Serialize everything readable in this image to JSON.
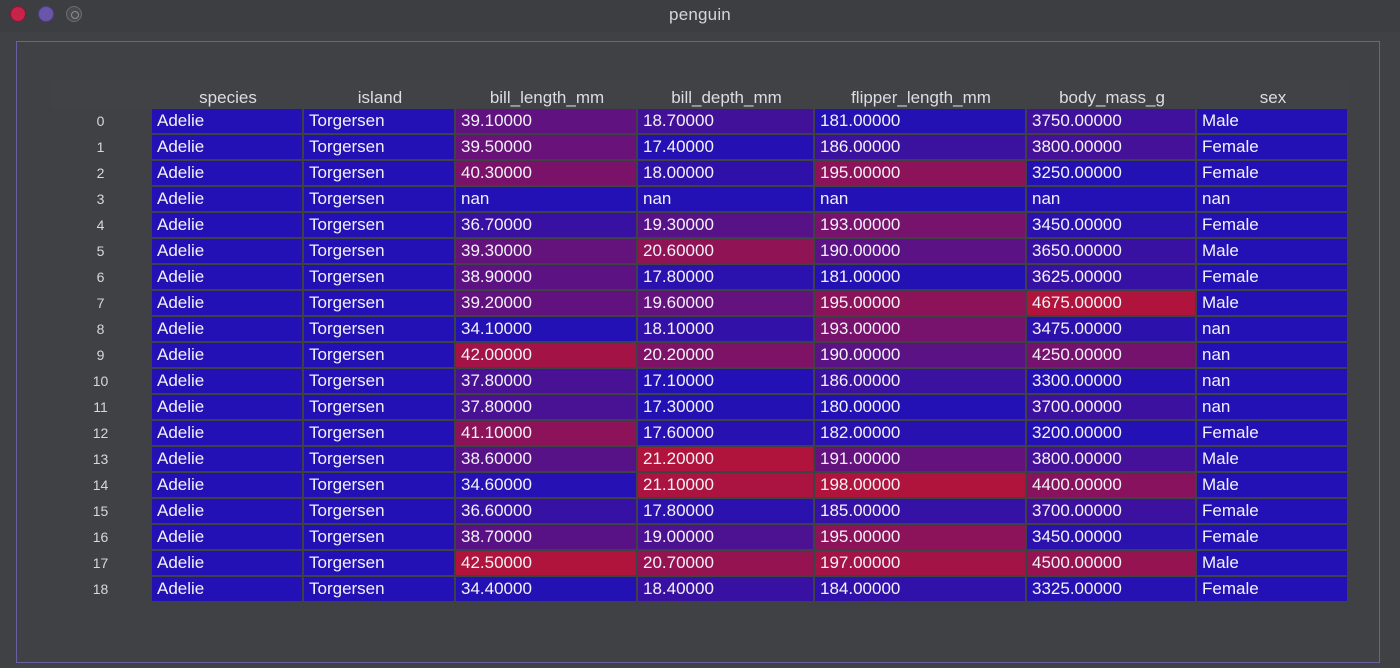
{
  "window": {
    "title": "penguin"
  },
  "colors": {
    "low": "#2311b5",
    "high": "#b0133b",
    "nan": "#2311b5"
  },
  "table": {
    "columns": [
      "species",
      "island",
      "bill_length_mm",
      "bill_depth_mm",
      "flipper_length_mm",
      "body_mass_g",
      "sex"
    ],
    "rows": [
      {
        "index": "0",
        "cells": [
          "Adelie",
          "Torgersen",
          "39.10000",
          "18.70000",
          "181.00000",
          "3750.00000",
          "Male"
        ]
      },
      {
        "index": "1",
        "cells": [
          "Adelie",
          "Torgersen",
          "39.50000",
          "17.40000",
          "186.00000",
          "3800.00000",
          "Female"
        ]
      },
      {
        "index": "2",
        "cells": [
          "Adelie",
          "Torgersen",
          "40.30000",
          "18.00000",
          "195.00000",
          "3250.00000",
          "Female"
        ]
      },
      {
        "index": "3",
        "cells": [
          "Adelie",
          "Torgersen",
          "nan",
          "nan",
          "nan",
          "nan",
          "nan"
        ]
      },
      {
        "index": "4",
        "cells": [
          "Adelie",
          "Torgersen",
          "36.70000",
          "19.30000",
          "193.00000",
          "3450.00000",
          "Female"
        ]
      },
      {
        "index": "5",
        "cells": [
          "Adelie",
          "Torgersen",
          "39.30000",
          "20.60000",
          "190.00000",
          "3650.00000",
          "Male"
        ]
      },
      {
        "index": "6",
        "cells": [
          "Adelie",
          "Torgersen",
          "38.90000",
          "17.80000",
          "181.00000",
          "3625.00000",
          "Female"
        ]
      },
      {
        "index": "7",
        "cells": [
          "Adelie",
          "Torgersen",
          "39.20000",
          "19.60000",
          "195.00000",
          "4675.00000",
          "Male"
        ]
      },
      {
        "index": "8",
        "cells": [
          "Adelie",
          "Torgersen",
          "34.10000",
          "18.10000",
          "193.00000",
          "3475.00000",
          "nan"
        ]
      },
      {
        "index": "9",
        "cells": [
          "Adelie",
          "Torgersen",
          "42.00000",
          "20.20000",
          "190.00000",
          "4250.00000",
          "nan"
        ]
      },
      {
        "index": "10",
        "cells": [
          "Adelie",
          "Torgersen",
          "37.80000",
          "17.10000",
          "186.00000",
          "3300.00000",
          "nan"
        ]
      },
      {
        "index": "11",
        "cells": [
          "Adelie",
          "Torgersen",
          "37.80000",
          "17.30000",
          "180.00000",
          "3700.00000",
          "nan"
        ]
      },
      {
        "index": "12",
        "cells": [
          "Adelie",
          "Torgersen",
          "41.10000",
          "17.60000",
          "182.00000",
          "3200.00000",
          "Female"
        ]
      },
      {
        "index": "13",
        "cells": [
          "Adelie",
          "Torgersen",
          "38.60000",
          "21.20000",
          "191.00000",
          "3800.00000",
          "Male"
        ]
      },
      {
        "index": "14",
        "cells": [
          "Adelie",
          "Torgersen",
          "34.60000",
          "21.10000",
          "198.00000",
          "4400.00000",
          "Male"
        ]
      },
      {
        "index": "15",
        "cells": [
          "Adelie",
          "Torgersen",
          "36.60000",
          "17.80000",
          "185.00000",
          "3700.00000",
          "Female"
        ]
      },
      {
        "index": "16",
        "cells": [
          "Adelie",
          "Torgersen",
          "38.70000",
          "19.00000",
          "195.00000",
          "3450.00000",
          "Female"
        ]
      },
      {
        "index": "17",
        "cells": [
          "Adelie",
          "Torgersen",
          "42.50000",
          "20.70000",
          "197.00000",
          "4500.00000",
          "Male"
        ]
      },
      {
        "index": "18",
        "cells": [
          "Adelie",
          "Torgersen",
          "34.40000",
          "18.40000",
          "184.00000",
          "3325.00000",
          "Female"
        ]
      }
    ]
  }
}
